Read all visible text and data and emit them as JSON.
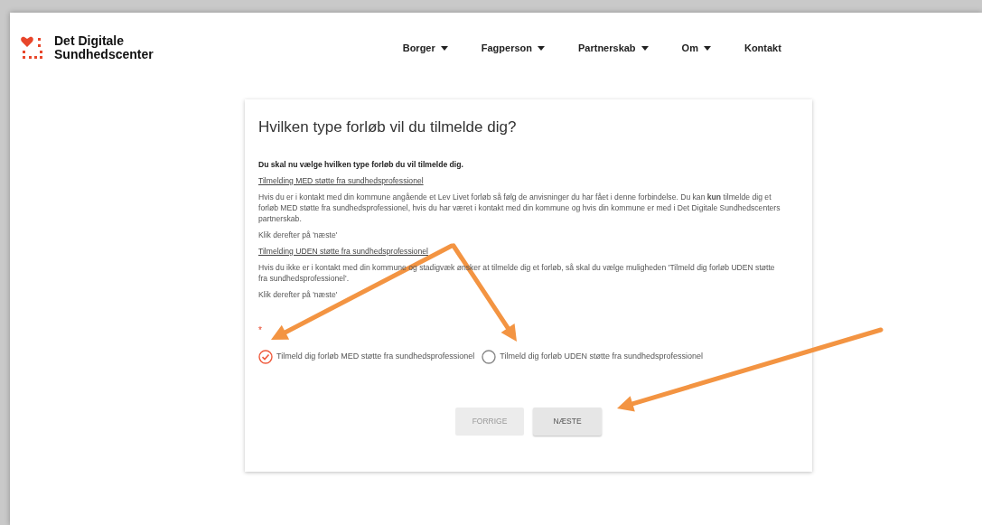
{
  "logo": {
    "line_1": "Det Digitale",
    "line_2": "Sundhedscenter"
  },
  "nav": [
    {
      "label": "Borger",
      "dropdown": true
    },
    {
      "label": "Fagperson",
      "dropdown": true
    },
    {
      "label": "Partnerskab",
      "dropdown": true
    },
    {
      "label": "Om",
      "dropdown": true
    },
    {
      "label": "Kontakt",
      "dropdown": false
    }
  ],
  "card": {
    "title": "Hvilken type forløb vil du tilmelde dig?",
    "paragraphs": [
      {
        "kind": "bold",
        "text": "Du skal nu vælge hvilken type forløb du vil tilmelde dig."
      },
      {
        "kind": "underline",
        "text": "Tilmelding MED støtte fra sundhedsprofessionel"
      },
      {
        "kind": "plain",
        "text": "Hvis du er i kontakt med din kommune angående et Lev Livet forløb så følg de anvisninger du har fået i denne forbindelse. Du kan **kun** tilmelde dig et forløb MED støtte fra sundhedsprofessionel, hvis du har været i kontakt med din kommune og hvis din kommune er med i Det Digitale Sundhedscenters partnerskab."
      },
      {
        "kind": "plain",
        "text": "Klik derefter på 'næste'"
      },
      {
        "kind": "underline",
        "text": "Tilmelding UDEN støtte fra sundhedsprofessionel"
      },
      {
        "kind": "plain",
        "text": "Hvis du ikke er i kontakt med din kommune og stadigvæk ønsker at tilmelde dig et forløb, så skal du vælge muligheden 'Tilmeld dig forløb UDEN støtte fra sundhedsprofessionel'."
      },
      {
        "kind": "plain",
        "text": "Klik derefter på 'næste'"
      }
    ],
    "required_mark": "*",
    "options": [
      {
        "label": "Tilmeld dig forløb MED støtte fra sundhedsprofessionel",
        "selected": true
      },
      {
        "label": "Tilmeld dig forløb UDEN støtte fra sundhedsprofessionel",
        "selected": false
      }
    ],
    "buttons": [
      {
        "label": "FORRIGE",
        "disabled": true
      },
      {
        "label": "NÆSTE",
        "disabled": false
      }
    ]
  }
}
